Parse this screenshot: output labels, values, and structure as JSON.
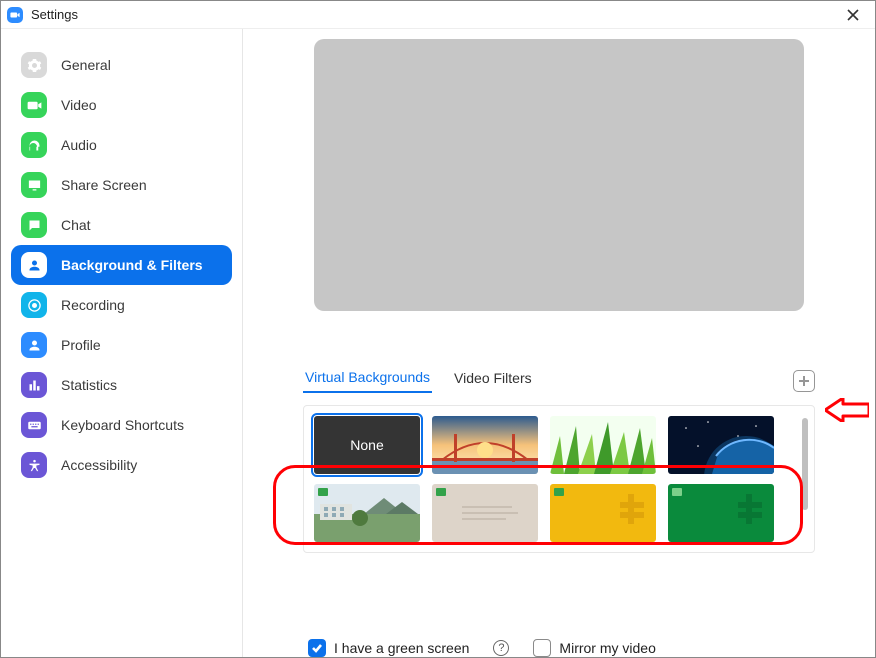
{
  "window": {
    "title": "Settings"
  },
  "sidebar": {
    "items": [
      {
        "label": "General",
        "icon": "gear-icon",
        "bg": "#d9d9d9"
      },
      {
        "label": "Video",
        "icon": "video-icon",
        "bg": "#36d45a"
      },
      {
        "label": "Audio",
        "icon": "headphones-icon",
        "bg": "#36d45a"
      },
      {
        "label": "Share Screen",
        "icon": "share-icon",
        "bg": "#36d45a"
      },
      {
        "label": "Chat",
        "icon": "chat-icon",
        "bg": "#36d45a"
      },
      {
        "label": "Background & Filters",
        "icon": "person-icon",
        "bg": "#0b71eb",
        "active": true
      },
      {
        "label": "Recording",
        "icon": "record-icon",
        "bg": "#11b4ea"
      },
      {
        "label": "Profile",
        "icon": "profile-icon",
        "bg": "#2d8cff"
      },
      {
        "label": "Statistics",
        "icon": "stats-icon",
        "bg": "#6b56d6"
      },
      {
        "label": "Keyboard Shortcuts",
        "icon": "keyboard-icon",
        "bg": "#6b56d6"
      },
      {
        "label": "Accessibility",
        "icon": "accessibility-icon",
        "bg": "#6b56d6"
      }
    ]
  },
  "tabs": {
    "virtual_bg": "Virtual Backgrounds",
    "video_filters": "Video Filters"
  },
  "gallery": {
    "none_label": "None"
  },
  "options": {
    "green_screen": "I have a green screen",
    "mirror": "Mirror my video"
  }
}
